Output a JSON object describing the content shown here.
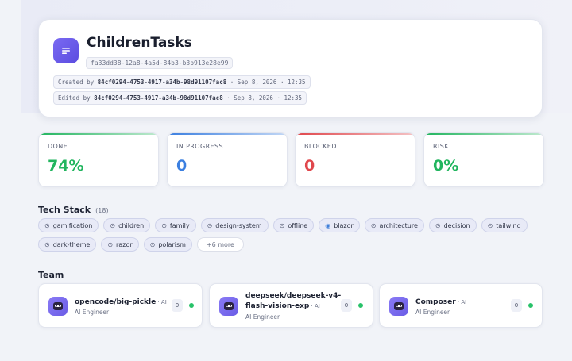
{
  "project": {
    "title": "ChildrenTasks",
    "id": "fa33dd38-12a8-4a5d-84b3-b3b913e28e99",
    "created_label": "Created by",
    "created_by": "84cf0294-4753-4917-a34b-98d91107fac8",
    "created_at": " · Sep 8, 2026 · 12:35",
    "edited_label": "Edited by",
    "edited_by": "84cf0294-4753-4917-a34b-98d91107fac8",
    "edited_at": " · Sep 8, 2026 · 12:35",
    "icon": "document-lines-icon"
  },
  "stats": [
    {
      "label": "DONE",
      "value": "74%",
      "color": "#22b55f"
    },
    {
      "label": "IN PROGRESS",
      "value": "0",
      "color": "#3b7fe0"
    },
    {
      "label": "BLOCKED",
      "value": "0",
      "color": "#e0474c"
    },
    {
      "label": "RISK",
      "value": "0%",
      "color": "#22b55f"
    }
  ],
  "tech_stack": {
    "title": "Tech Stack",
    "count": "(18)",
    "tags": [
      "gamification",
      "children",
      "family",
      "design-system",
      "offline",
      "blazor",
      "architecture",
      "decision",
      "tailwind",
      "dark-theme",
      "razor",
      "polarism"
    ],
    "more": "+6 more"
  },
  "team": {
    "title": "Team",
    "members": [
      {
        "name": "opencode/big-pickle",
        "sep": " · AI",
        "role": "AI Engineer",
        "count": "0"
      },
      {
        "name_line1": "deepseek/deepseek-v4-",
        "name_line2": "flash-vision-exp",
        "sep": " · AI",
        "role": "AI Engineer",
        "count": "0"
      },
      {
        "name": "Composer",
        "sep": " · AI",
        "role": "AI Engineer",
        "count": "0"
      }
    ],
    "status_color": "#28c269"
  }
}
